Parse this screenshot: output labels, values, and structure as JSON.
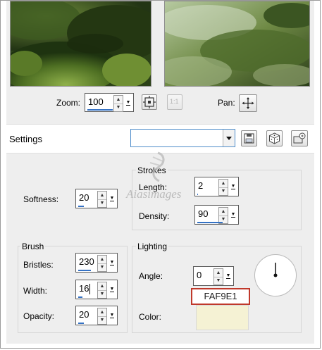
{
  "zoom": {
    "label": "Zoom:",
    "value": "100",
    "fit_icon": "fit-window-icon",
    "actual_size_icon": "actual-size-icon",
    "actual_size_text": "1:1"
  },
  "pan": {
    "label": "Pan:",
    "icon": "move-icon"
  },
  "settings": {
    "label": "Settings",
    "preset_value": "",
    "save_icon": "floppy-disk-icon",
    "random_icon": "dice-icon",
    "manage_icon": "preset-manager-icon"
  },
  "softness": {
    "label": "Softness:",
    "value": "20",
    "level": 20
  },
  "strokes": {
    "title": "Strokes",
    "length_label": "Length:",
    "length_value": "2",
    "length_level": 2,
    "density_label": "Density:",
    "density_value": "90",
    "density_level": 90
  },
  "brush": {
    "title": "Brush",
    "bristles_label": "Bristles:",
    "bristles_value": "230",
    "bristles_level": 46,
    "width_label": "Width:",
    "width_value": "16",
    "width_level": 16,
    "opacity_label": "Opacity:",
    "opacity_value": "20",
    "opacity_level": 20
  },
  "lighting": {
    "title": "Lighting",
    "angle_label": "Angle:",
    "angle_value": "0",
    "angle_level": 0,
    "color_label": "Color:",
    "color_swatch": "#f5f2d4",
    "color_hex": "FAF9E1"
  },
  "watermark": {
    "text": "Aiasimages"
  }
}
